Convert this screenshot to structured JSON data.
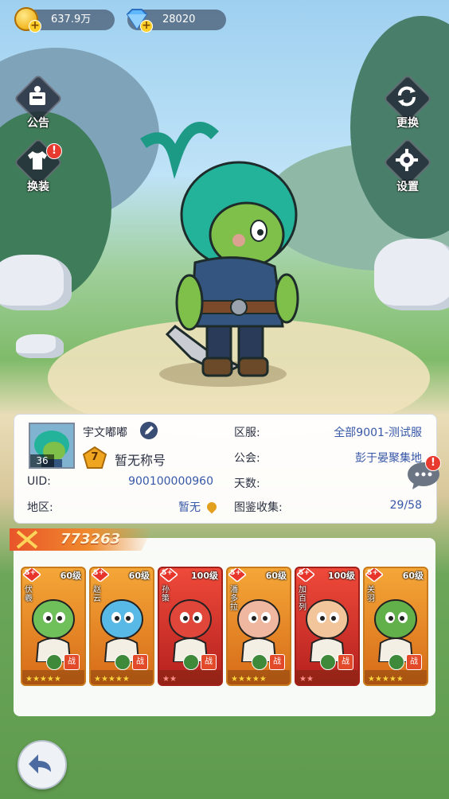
{
  "currency": {
    "coins": "637.9万",
    "gems": "28020"
  },
  "side_buttons": {
    "announcement": "公告",
    "dress_up": "换装",
    "change": "更换",
    "settings": "设置"
  },
  "profile": {
    "avatar_level": "36",
    "name": "宇文嘟嘟",
    "title_level": "7",
    "title": "暂无称号",
    "uid_label": "UID:",
    "uid": "900100000960",
    "region_label": "地区:",
    "region": "暂无",
    "server_label": "区服:",
    "server": "全部9001-测试服",
    "guild_label": "公会:",
    "guild": "彭于晏聚集地",
    "days_label": "天数:",
    "days": "",
    "codex_label": "图鉴收集:",
    "codex": "29/58"
  },
  "combat_power": "773263",
  "heroes": [
    {
      "name": "伏羲",
      "level": "60级",
      "rarity": "S+",
      "stars": "★★★★★",
      "frame": "orange"
    },
    {
      "name": "赵云",
      "level": "60级",
      "rarity": "S+",
      "stars": "★★★★★",
      "frame": "orange"
    },
    {
      "name": "孙策",
      "level": "100级",
      "rarity": "S+",
      "stars": "★★",
      "frame": "red"
    },
    {
      "name": "潘多拉",
      "level": "60级",
      "rarity": "S+",
      "stars": "★★★★★",
      "frame": "orange"
    },
    {
      "name": "加百列",
      "level": "100级",
      "rarity": "S+",
      "stars": "★★",
      "frame": "red"
    },
    {
      "name": "关羽",
      "level": "60级",
      "rarity": "S+",
      "stars": "★★★★★",
      "frame": "orange"
    }
  ],
  "hero_badge_label": "战",
  "colors": {
    "accent": "#3757a8",
    "alert": "#e83a2e",
    "power_ribbon": "#e8552a"
  },
  "icons": [
    "coin-icon",
    "gem-icon",
    "announcement-icon",
    "shirt-icon",
    "refresh-icon",
    "gear-icon",
    "edit-icon",
    "chat-icon",
    "back-arrow-icon",
    "location-pin-icon"
  ]
}
